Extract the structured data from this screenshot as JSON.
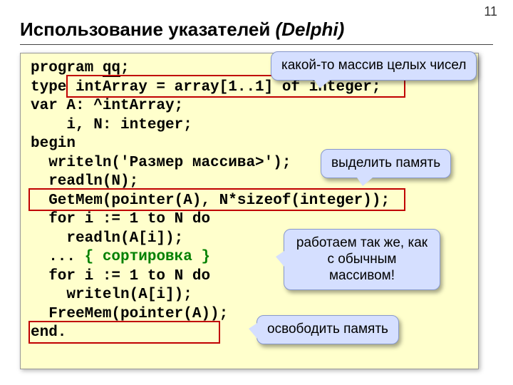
{
  "page_number": "11",
  "title_plain": "Использование указателей ",
  "title_italic": "(Delphi)",
  "code": {
    "l1a": "program ",
    "l1b": "qq",
    "l1c": ";",
    "l2a": "type ",
    "l2b": "intArray = array[1..1] of integer;",
    "l3": "var A: ^intArray;",
    "l4": "    i, N: integer;",
    "l5": "begin",
    "l6": "  writeln('Размер массива>');",
    "l7": "  readln(N);",
    "l8": "  GetMem(pointer(A), N*sizeof(integer));",
    "l9": "  for i := 1 to N do",
    "l10": "    readln(A[i]);",
    "l11a": "  ... ",
    "l11b": "{ сортировка }",
    "l12": "  for i := 1 to N do",
    "l13": "    writeln(A[i]);",
    "l14": "  FreeMem(pointer(A));",
    "l15": "end."
  },
  "callouts": {
    "c1": "какой-то массив целых чисел",
    "c2": "выделить память",
    "c3": "работаем так же, как с обычным массивом!",
    "c4": "освободить память"
  }
}
